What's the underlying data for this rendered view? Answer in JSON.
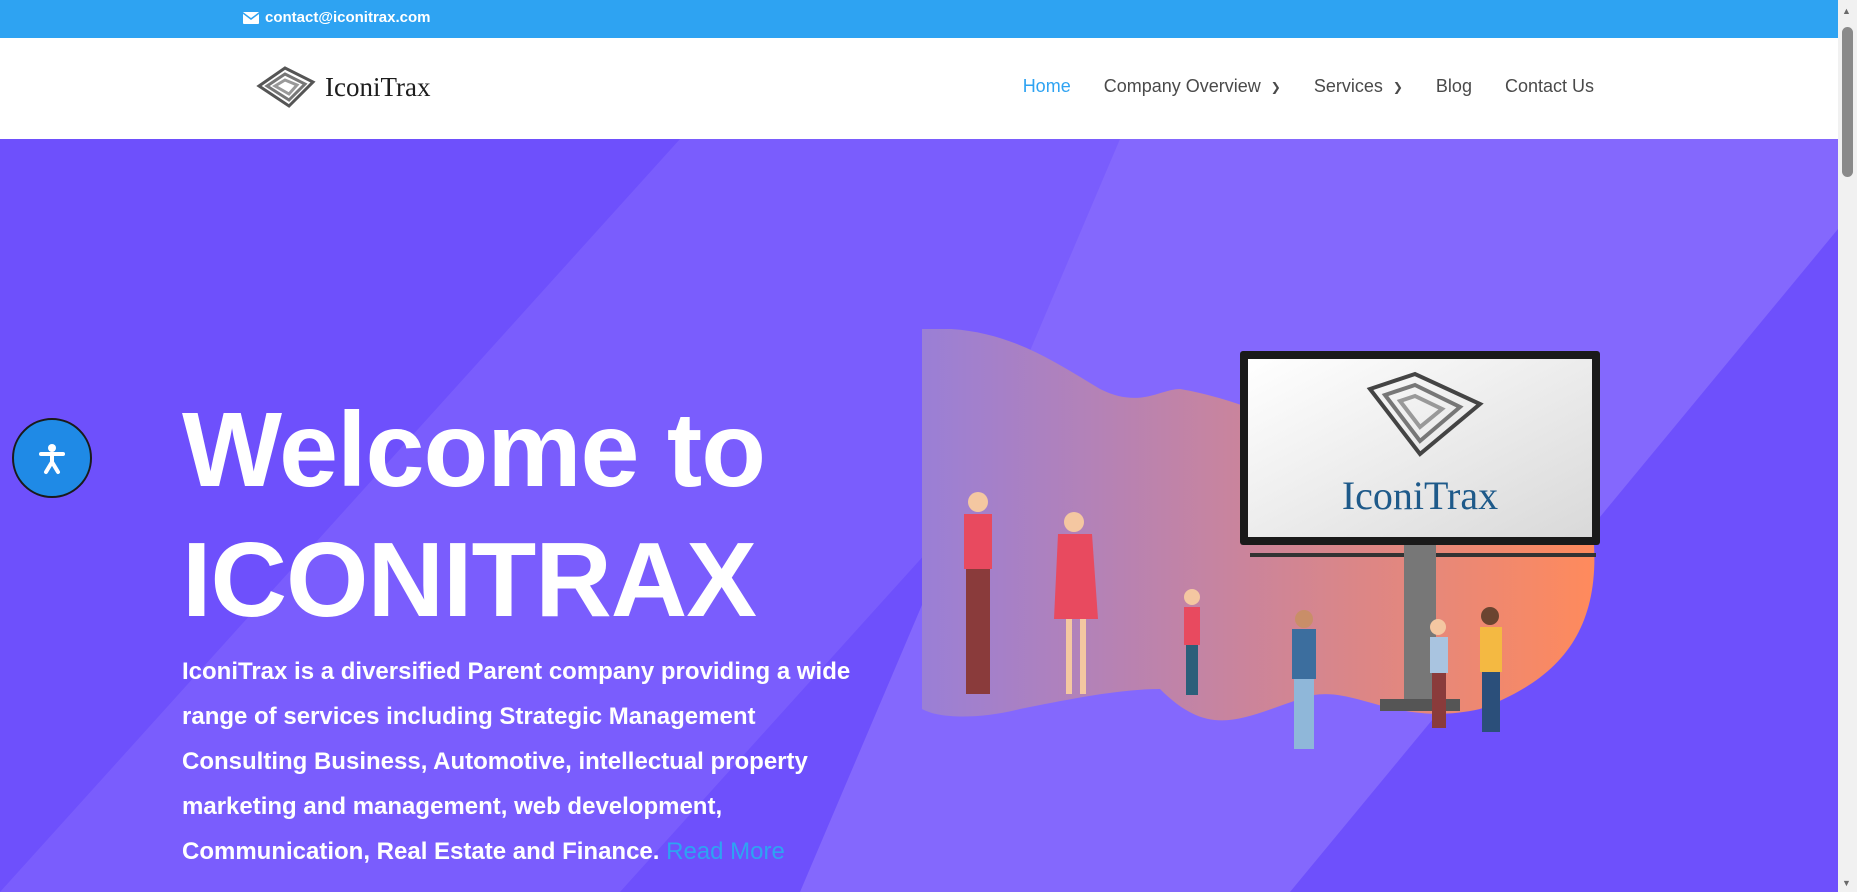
{
  "topbar": {
    "email": "contact@iconitrax.com",
    "icon": "mail-icon"
  },
  "header": {
    "logo_text": "IconiTrax",
    "nav": [
      {
        "label": "Home",
        "active": true,
        "has_dropdown": false
      },
      {
        "label": "Company Overview",
        "active": false,
        "has_dropdown": true
      },
      {
        "label": "Services",
        "active": false,
        "has_dropdown": true
      },
      {
        "label": "Blog",
        "active": false,
        "has_dropdown": false
      },
      {
        "label": "Contact Us",
        "active": false,
        "has_dropdown": false
      }
    ]
  },
  "hero": {
    "title_line1": "Welcome to",
    "title_line2": "ICONITRAX",
    "description": "IconiTrax is a diversified Parent company providing a wide range of services including Strategic Management Consulting Business, Automotive, intellectual property marketing and management, web development, Communication, Real Estate and Finance.",
    "read_more": "Read More",
    "billboard_text": "IconiTrax"
  },
  "colors": {
    "accent": "#2ea3f2",
    "hero_bg": "#6e50fc",
    "hero_stripe": "#8468fd"
  },
  "accessibility_button": {
    "icon": "accessibility-icon"
  }
}
